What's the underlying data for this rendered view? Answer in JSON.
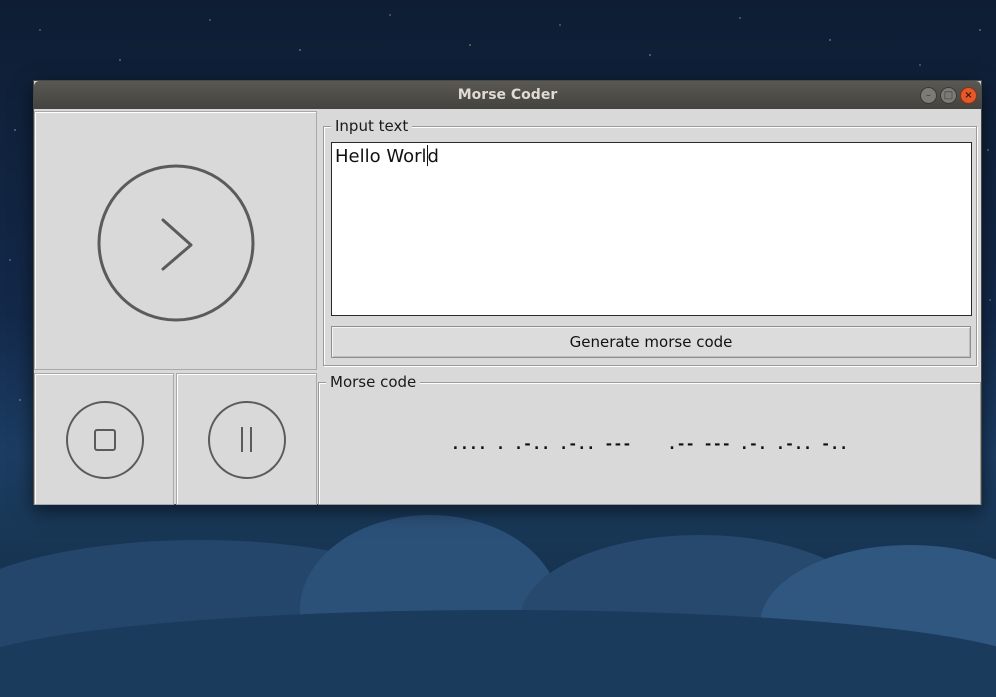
{
  "window": {
    "title": "Morse Coder",
    "controls": {
      "minimize": "–",
      "maximize": "□",
      "close": "×"
    }
  },
  "player": {
    "play_icon": "play-chevron-icon",
    "stop_icon": "stop-square-icon",
    "pause_icon": "pause-bars-icon"
  },
  "input": {
    "label": "Input text",
    "value_before_caret": "Hello Worl",
    "value_after_caret": "d"
  },
  "generate_button": {
    "label": "Generate morse code"
  },
  "output": {
    "label": "Morse code",
    "value": ".... . .-.. .-.. ---    .-- --- .-. .-.. -.."
  },
  "colors": {
    "window_bg": "#d9d9d9",
    "titlebar": "#4f4d48",
    "close_button": "#e25a2a",
    "icon_stroke": "#5b5b5b"
  }
}
